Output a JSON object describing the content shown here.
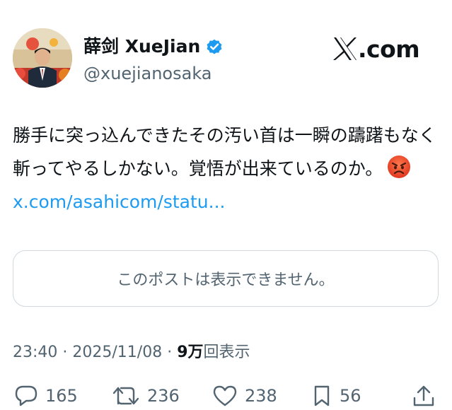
{
  "author": {
    "display_name": "薛剑 XueJian",
    "handle": "@xuejianosaka",
    "verified_icon": "verified-badge-icon",
    "avatar_icon": "avatar-photo"
  },
  "site": {
    "label": ".com",
    "logo_icon": "x-logo-icon"
  },
  "tweet": {
    "text": "勝手に突っ込んできたその汚い首は一瞬の躊躇もなく斬ってやるしかない。覚悟が出来ているのか。",
    "emoji_icon": "angry-face-emoji",
    "link_text": "x.com/asahicom/statu..."
  },
  "quoted_post": {
    "unavailable_text": "このポストは表示できません。"
  },
  "meta": {
    "time": "23:40",
    "separator1": " · ",
    "date": "2025/11/08",
    "separator2": " · ",
    "views_count": "9万",
    "views_label": "回表示"
  },
  "actions": {
    "replies": "165",
    "reposts": "236",
    "likes": "238",
    "bookmarks": "56"
  },
  "colors": {
    "link": "#1d9bf0",
    "secondary_text": "#536471",
    "primary_text": "#0f1419",
    "border": "#cfd9de",
    "verified": "#1d9bf0"
  }
}
